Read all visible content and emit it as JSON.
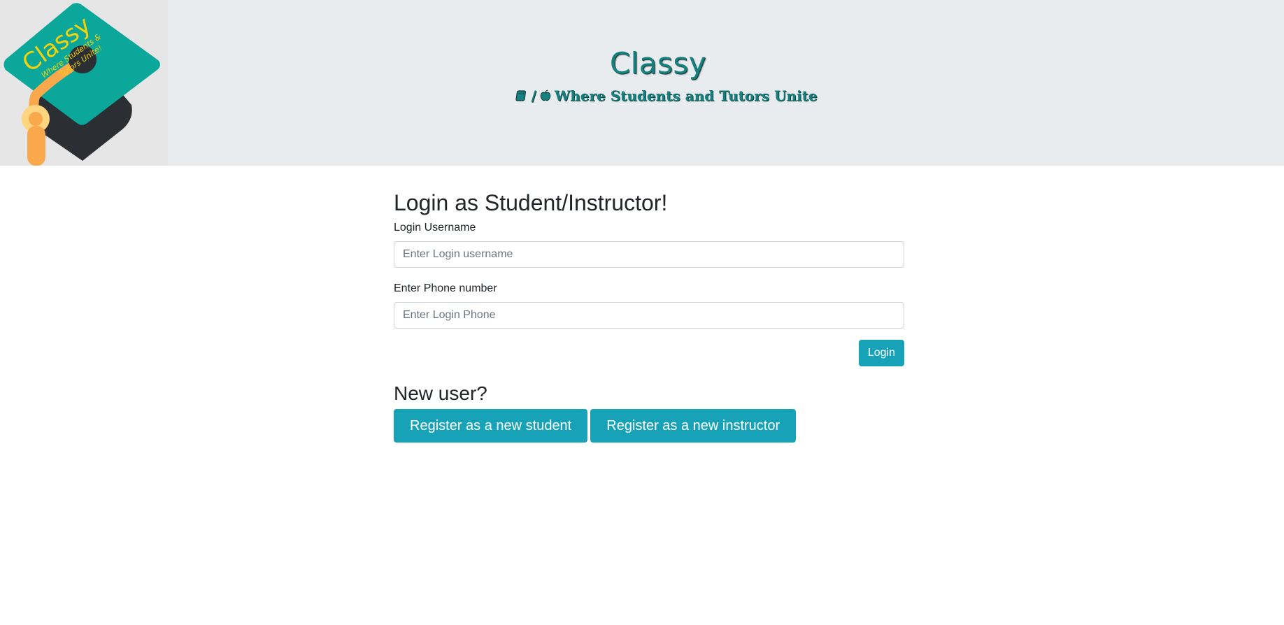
{
  "header": {
    "logo": {
      "word": "Classy",
      "tagline_line1": "Where Students &",
      "tagline_line2": "Tutors Unite!"
    },
    "title": "Classy",
    "subtitle_separator": "/",
    "subtitle": "Where Students and Tutors Unite",
    "subtitle_icons": [
      "book-icon",
      "apple-icon"
    ]
  },
  "login": {
    "heading": "Login as Student/Instructor!",
    "username_label": "Login Username",
    "username_placeholder": "Enter Login username",
    "username_value": "",
    "phone_label": "Enter Phone number",
    "phone_placeholder": "Enter Login Phone",
    "phone_value": "",
    "submit_label": "Login"
  },
  "register": {
    "heading": "New user?",
    "student_button": "Register as a new student",
    "instructor_button": "Register as a new instructor"
  },
  "colors": {
    "header_bg": "#e9ecef",
    "brand_teal": "#17817f",
    "button": "#17a2b8",
    "logo_cap": "#0aa79a",
    "logo_dark": "#2b2f33",
    "logo_tassel": "#f9a94c",
    "logo_text": "#f5d20a"
  }
}
